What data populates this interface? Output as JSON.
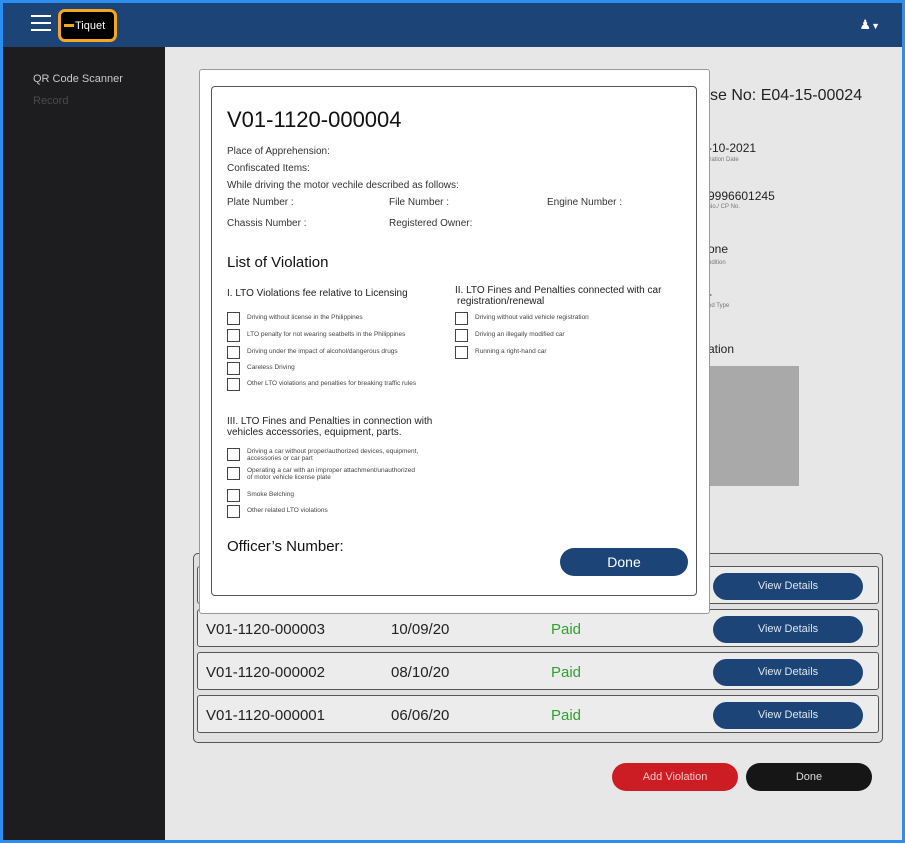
{
  "app": {
    "logo_text": "Tiquet"
  },
  "sidebar": {
    "items": [
      {
        "label": "QR Code Scanner"
      },
      {
        "label": "Record"
      }
    ]
  },
  "background": {
    "title": "se No: E04-15-00024",
    "fields": [
      {
        "value": "-10-2021",
        "caption": "iration Date"
      },
      {
        "value": "9996601245",
        "caption": "No./ CP No."
      },
      {
        "value": "one",
        "caption": "ndition"
      },
      {
        "value": "-",
        "caption": "od Type"
      }
    ],
    "section": "ation"
  },
  "violations_table": {
    "rows": [
      {
        "id": "V01-1120-000003",
        "date": "10/09/20",
        "status": "Paid",
        "button": "View Details"
      },
      {
        "id": "V01-1120-000002",
        "date": "08/10/20",
        "status": "Paid",
        "button": "View Details"
      },
      {
        "id": "V01-1120-000001",
        "date": "06/06/20",
        "status": "Paid",
        "button": "View Details"
      }
    ],
    "hidden_row_button": "View Details"
  },
  "actions": {
    "add_violation": "Add Violation",
    "done": "Done"
  },
  "modal": {
    "title": "V01-1120-000004",
    "place": "Place of Apprehension:",
    "confiscated": "Confiscated Items:",
    "driving_note": "While driving the motor vechile described as follows:",
    "plate": "Plate Number :",
    "file": "File Number :",
    "engine": "Engine Number :",
    "chassis": "Chassis Number :",
    "owner": "Registered Owner:",
    "list_title": "List of Violation",
    "section1": {
      "title": "I. LTO Violations fee relative to Licensing",
      "items": [
        "Driving without license in the Philippines",
        "LTO penalty for not wearing seatbelts in the Philippines",
        "Driving under the impact of alcohol/dangerous drugs",
        "Careless Driving",
        "Other LTO violations and penalties for breaking traffic rules"
      ]
    },
    "section2": {
      "title_line1": "II. LTO Fines and Penalties connected with car",
      "title_line2": "registration/renewal",
      "items": [
        "Driving without  valid vehicle registration",
        "Driving an illegally modified car",
        "Running a right-hand car"
      ]
    },
    "section3": {
      "title_line1": "III. LTO Fines and Penalties in connection with",
      "title_line2": "vehicles accessories, equipment, parts.",
      "items": [
        {
          "line1": "Driving a car without proper/authorized devices, equipment,",
          "line2": "accessories or car part"
        },
        {
          "line1": "Operating a car  with an improper attachment/unauthorized",
          "line2": "of motor vehicle license plate"
        },
        {
          "line1": "Smoke Belching",
          "line2": ""
        },
        {
          "line1": "Other related LTO violations",
          "line2": ""
        }
      ]
    },
    "officer": "Officer’s Number:",
    "done": "Done"
  }
}
